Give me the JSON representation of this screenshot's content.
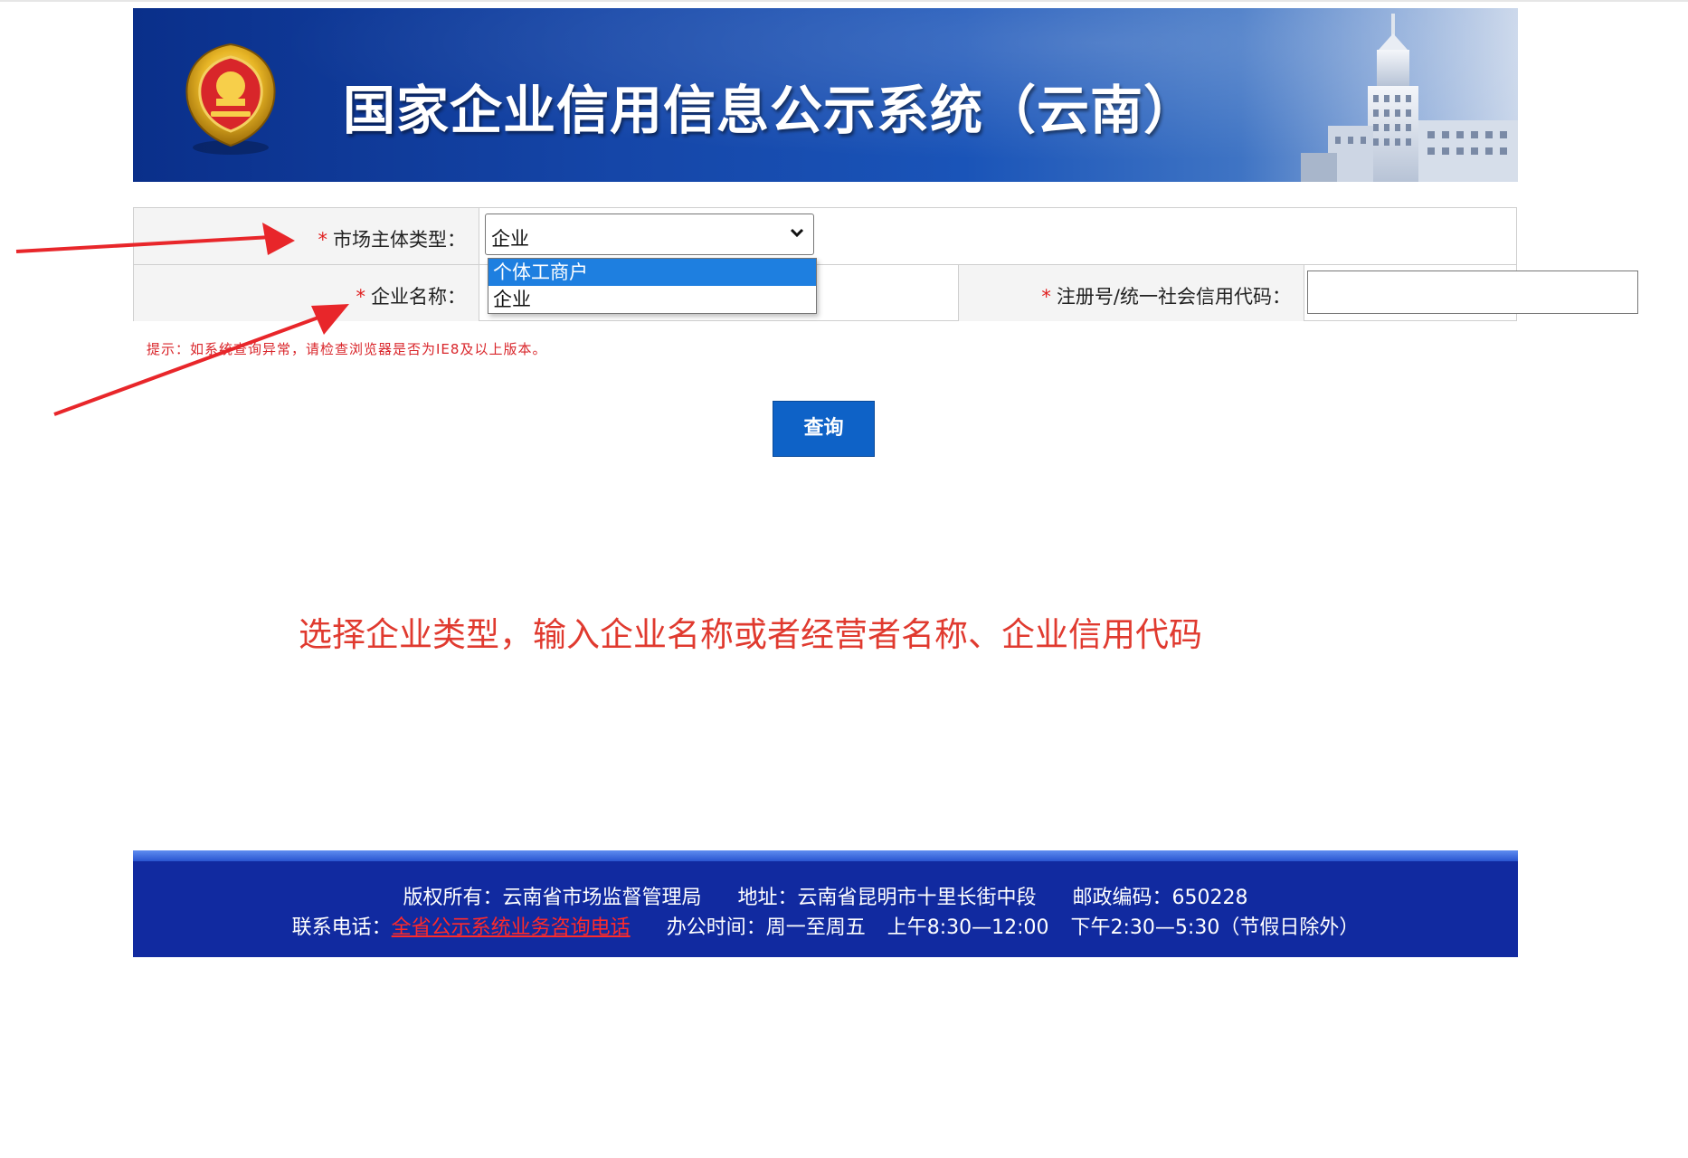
{
  "banner": {
    "title": "国家企业信用信息公示系统（云南）",
    "emblem_icon": "national-emblem-icon",
    "building_icon": "building-icon"
  },
  "form": {
    "market_type": {
      "required_mark": "*",
      "label": "市场主体类型：",
      "selected": "企业",
      "options": [
        "个体工商户",
        "企业"
      ],
      "highlighted_option": "个体工商户"
    },
    "company_name": {
      "required_mark": "*",
      "label": "企业名称：",
      "value": ""
    },
    "reg_code": {
      "required_mark": "*",
      "label": "注册号/统一社会信用代码：",
      "value": ""
    }
  },
  "hint": "提示：如系统查询异常，请检查浏览器是否为IE8及以上版本。",
  "query_button": "查询",
  "annotation": "选择企业类型，输入企业名称或者经营者名称、企业信用代码",
  "footer": {
    "copyright": "版权所有：云南省市场监督管理局",
    "address": "地址：云南省昆明市十里长街中段",
    "postcode": "邮政编码：650228",
    "phone_label": "联系电话：",
    "phone_link": "全省公示系统业务咨询电话",
    "office_hours": "办公时间：周一至周五",
    "morning": "上午8:30—12:00",
    "afternoon": "下午2:30—5:30（节假日除外）"
  },
  "colors": {
    "banner_blue": "#1546a8",
    "footer_blue": "#112aa0",
    "button_blue": "#0e62c7",
    "required_red": "#e02020",
    "annotation_red": "#e03a2f",
    "arrow_red": "#e8262a"
  }
}
